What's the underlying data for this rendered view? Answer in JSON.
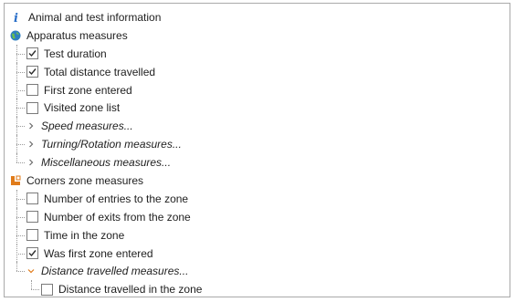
{
  "tree": {
    "animal_info": {
      "label": "Animal and test information",
      "icon": "info-icon"
    },
    "apparatus": {
      "label": "Apparatus measures",
      "icon": "globe-icon",
      "items": [
        {
          "label": "Test duration",
          "checked": true
        },
        {
          "label": "Total distance travelled",
          "checked": true
        },
        {
          "label": "First zone entered",
          "checked": false
        },
        {
          "label": "Visited zone list",
          "checked": false
        }
      ],
      "groups": [
        {
          "label": "Speed measures...",
          "expanded": false
        },
        {
          "label": "Turning/Rotation measures...",
          "expanded": false
        },
        {
          "label": "Miscellaneous measures...",
          "expanded": false
        }
      ]
    },
    "corners": {
      "label": "Corners zone measures",
      "icon": "corner-zone-icon",
      "items": [
        {
          "label": "Number of entries to the zone",
          "checked": false
        },
        {
          "label": "Number of exits from the zone",
          "checked": false
        },
        {
          "label": "Time in the zone",
          "checked": false
        },
        {
          "label": "Was first zone entered",
          "checked": true
        }
      ],
      "group": {
        "label": "Distance travelled measures...",
        "expanded": true,
        "items": [
          {
            "label": "Distance travelled in the zone",
            "checked": false
          }
        ]
      }
    }
  },
  "colors": {
    "info_icon": "#2a6fc9",
    "globe_icon": "#2f7fbf",
    "corner_icon": "#e07b1a",
    "check": "#2d2d2d",
    "guide": "#9a9a9a"
  }
}
